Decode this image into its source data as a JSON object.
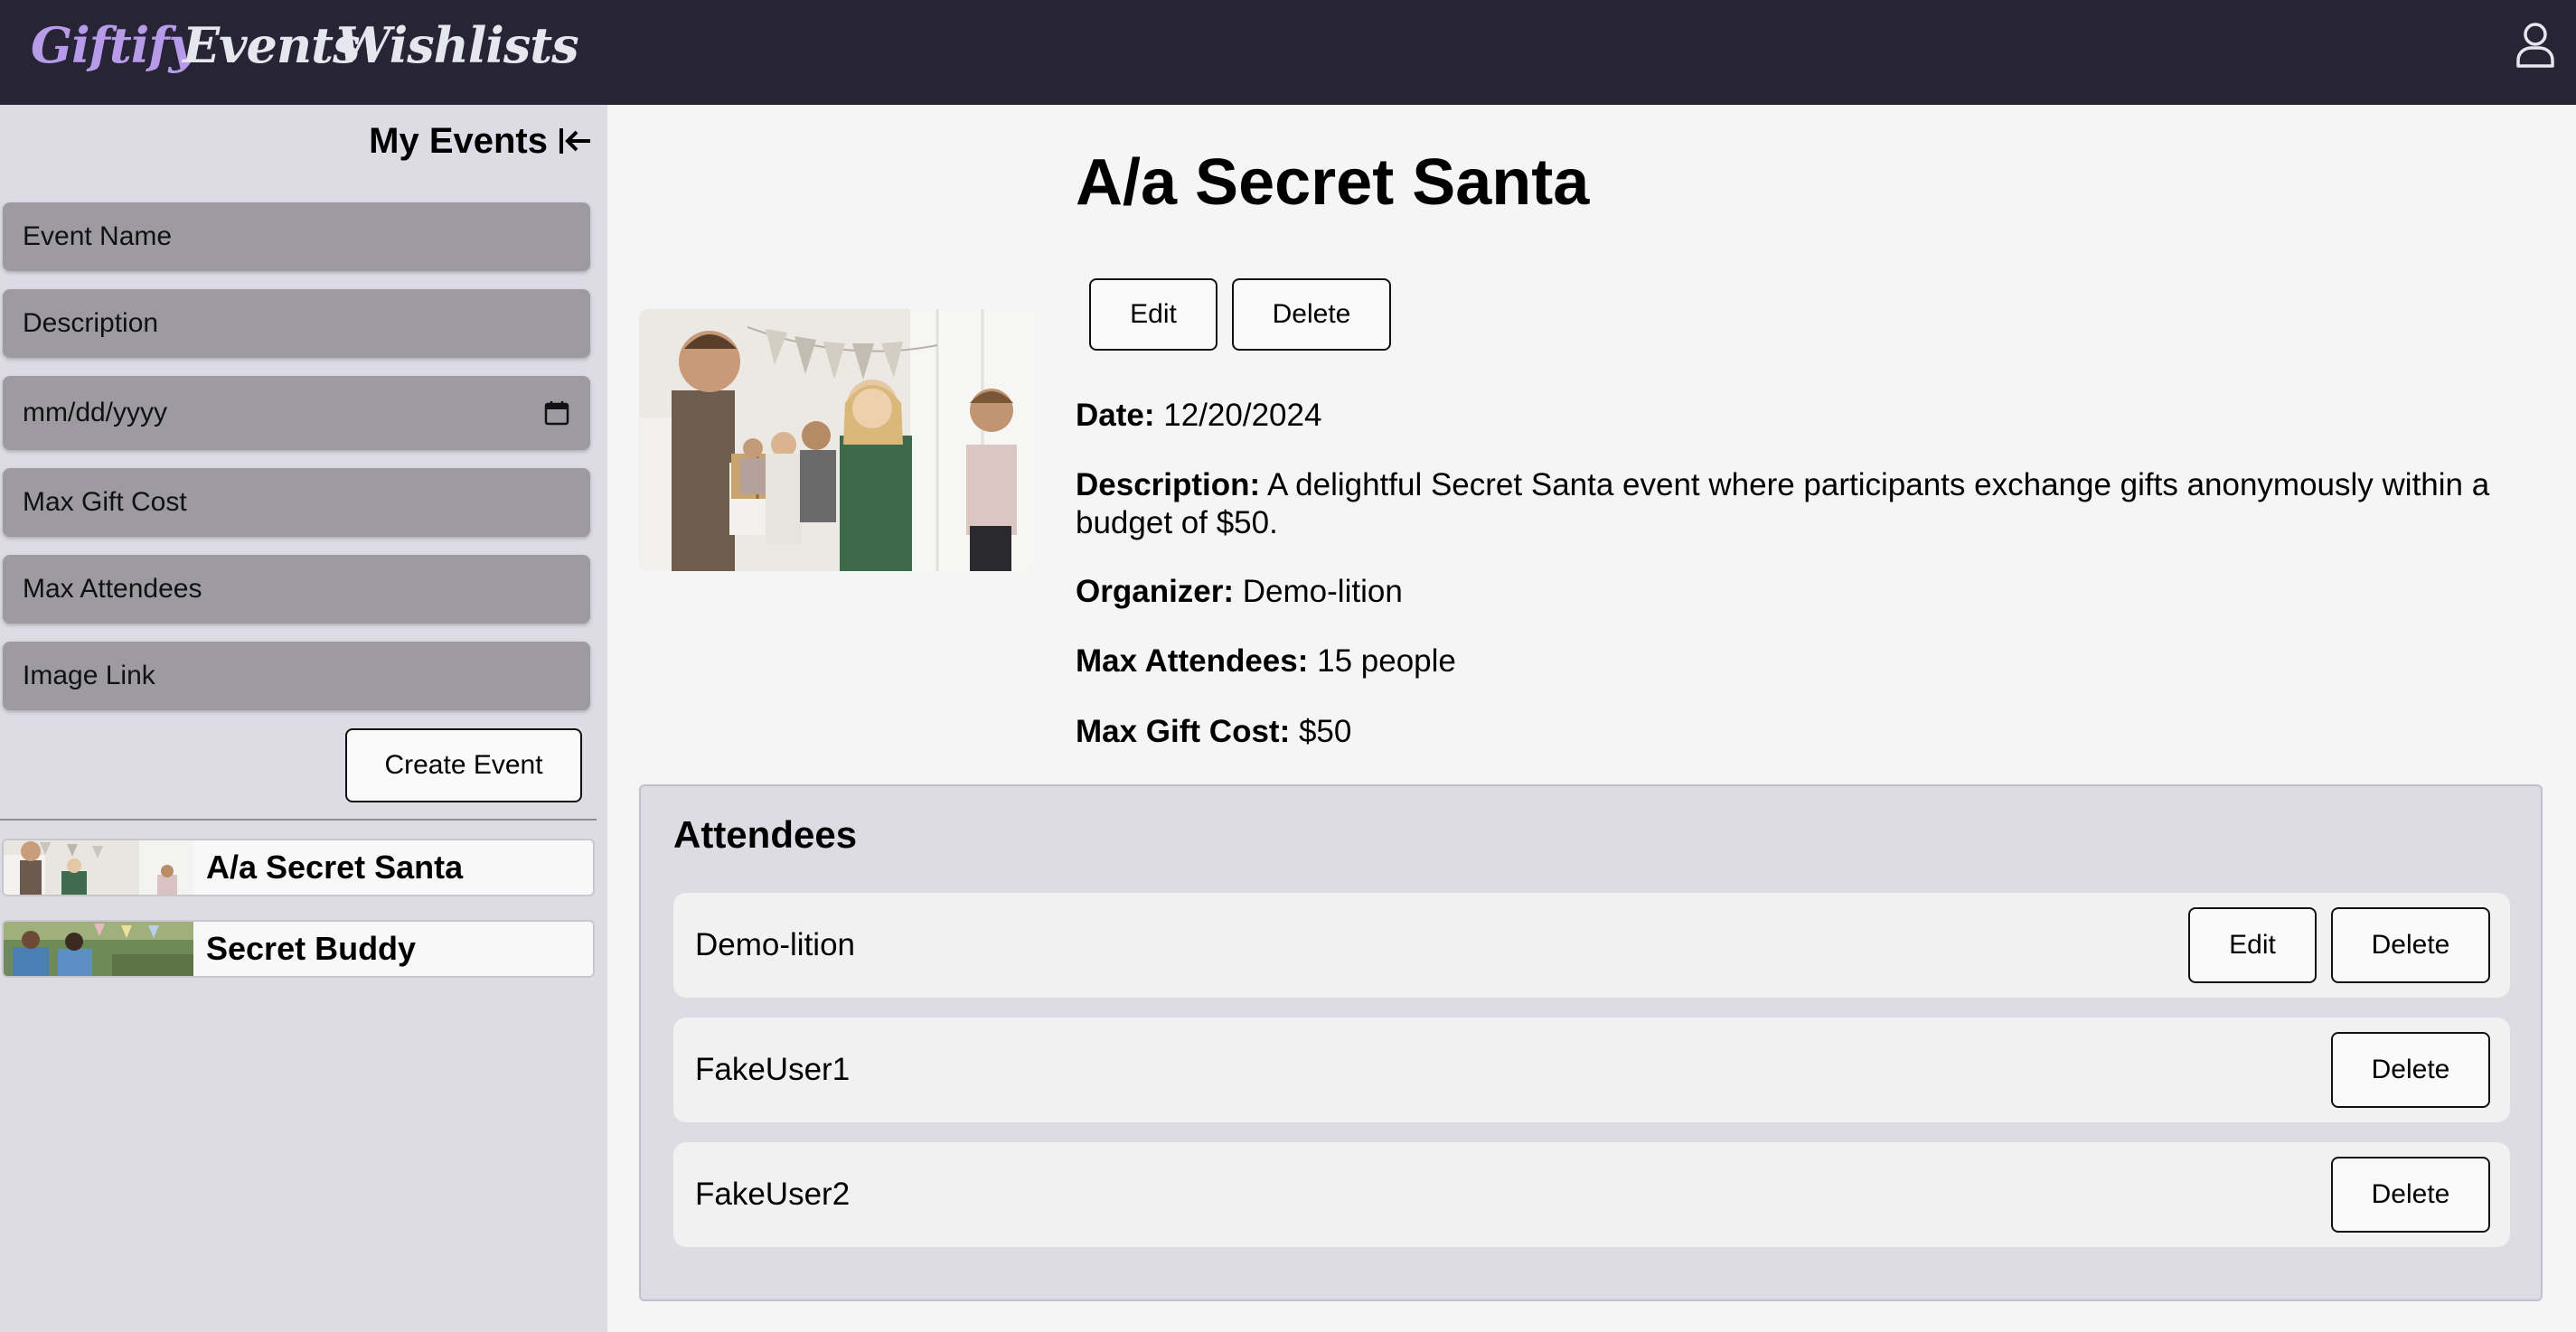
{
  "nav": {
    "brand": "Giftify",
    "links": [
      "Events",
      "Wishlists"
    ],
    "user_icon": "user-icon"
  },
  "sidebar": {
    "title": "My Events",
    "collapse_icon": "collapse-left-icon",
    "fields": {
      "event_name": "Event Name",
      "description": "Description",
      "date": "mm/dd/yyyy",
      "max_gift_cost": "Max Gift Cost",
      "max_attendees": "Max Attendees",
      "image_link": "Image Link"
    },
    "create_button": "Create Event",
    "events": [
      {
        "name": "A/a Secret Santa"
      },
      {
        "name": "Secret Buddy"
      }
    ]
  },
  "event": {
    "title": "A/a Secret Santa",
    "edit_label": "Edit",
    "delete_label": "Delete",
    "date_label": "Date:",
    "date": "12/20/2024",
    "description_label": "Description:",
    "description": "A delightful Secret Santa event where participants exchange gifts anonymously within a budget of $50.",
    "organizer_label": "Organizer:",
    "organizer": "Demo-lition",
    "max_attendees_label": "Max Attendees:",
    "max_attendees": "15 people",
    "max_gift_cost_label": "Max Gift Cost:",
    "max_gift_cost": "$50"
  },
  "attendees": {
    "title": "Attendees",
    "rows": [
      {
        "name": "Demo-lition",
        "edit": "Edit",
        "delete": "Delete"
      },
      {
        "name": "FakeUser1",
        "delete": "Delete"
      },
      {
        "name": "FakeUser2",
        "delete": "Delete"
      }
    ]
  },
  "colors": {
    "nav_bg": "#272436",
    "brand": "#b79be8",
    "sidebar_bg": "#dddbe4",
    "field_bg": "#9d9ba1",
    "page_bg": "#f5f5f5"
  }
}
